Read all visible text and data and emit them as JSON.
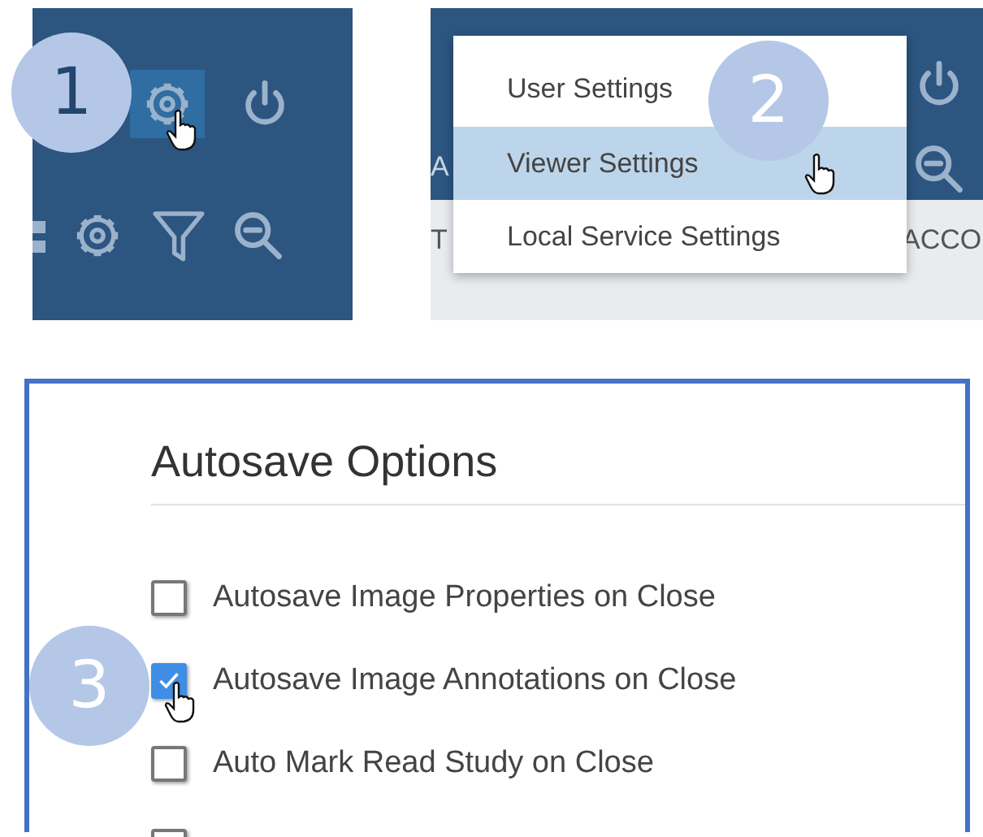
{
  "step_1": {
    "badge": "1",
    "buttons": [
      {
        "selected": true
      },
      {
        "selected": false
      }
    ]
  },
  "step_2": {
    "badge": "2",
    "background_texts": [
      "A",
      "T",
      "ACCO"
    ],
    "menu": [
      {
        "label": "User Settings",
        "selected": false
      },
      {
        "label": "Viewer Settings",
        "selected": true
      },
      {
        "label": "Local Service Settings",
        "selected": false
      }
    ]
  },
  "step_3": {
    "badge": "3",
    "title": "Autosave Options",
    "options": [
      {
        "label": "Autosave Image Properties on Close",
        "checked": false
      },
      {
        "label": "Autosave Image Annotations on Close",
        "checked": true
      },
      {
        "label": "Auto Mark Read Study on Close",
        "checked": false
      },
      {
        "checked": false
      }
    ]
  }
}
